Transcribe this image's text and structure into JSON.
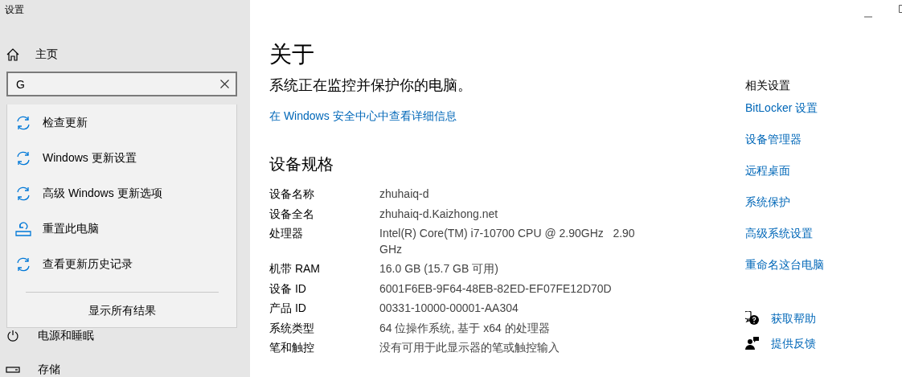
{
  "window": {
    "title": "设置"
  },
  "sidebar": {
    "home": "主页",
    "search": {
      "value": "G"
    },
    "suggestions": [
      {
        "label": "检查更新",
        "kind": "update"
      },
      {
        "label": "Windows 更新设置",
        "kind": "update"
      },
      {
        "label": "高级 Windows 更新选项",
        "kind": "update"
      },
      {
        "label": "重置此电脑",
        "kind": "reset"
      },
      {
        "label": "查看更新历史记录",
        "kind": "update"
      }
    ],
    "show_all": "显示所有结果",
    "items": [
      {
        "label": "电源和睡眠",
        "kind": "power"
      },
      {
        "label": "存储",
        "kind": "storage"
      }
    ]
  },
  "main": {
    "title": "关于",
    "status": "系统正在监控并保护你的电脑。",
    "security_link": "在 Windows 安全中心中查看详细信息",
    "specs_title": "设备规格",
    "specs": [
      {
        "label": "设备名称",
        "value": "zhuhaiq-d"
      },
      {
        "label": "设备全名",
        "value": "zhuhaiq-d.Kaizhong.net"
      },
      {
        "label": "处理器",
        "value": "Intel(R) Core(TM) i7-10700 CPU @ 2.90GHz   2.90 GHz"
      },
      {
        "label": "机带 RAM",
        "value": "16.0 GB (15.7 GB 可用)"
      },
      {
        "label": "设备 ID",
        "value": "6001F6EB-9F64-48EB-82ED-EF07FE12D70D"
      },
      {
        "label": "产品 ID",
        "value": "00331-10000-00001-AA304"
      },
      {
        "label": "系统类型",
        "value": "64 位操作系统, 基于 x64 的处理器"
      },
      {
        "label": "笔和触控",
        "value": "没有可用于此显示器的笔或触控输入"
      }
    ]
  },
  "related": {
    "title": "相关设置",
    "links": [
      "BitLocker 设置",
      "设备管理器",
      "远程桌面",
      "系统保护",
      "高级系统设置",
      "重命名这台电脑"
    ]
  },
  "support": [
    {
      "label": "获取帮助",
      "kind": "help"
    },
    {
      "label": "提供反馈",
      "kind": "feedback"
    }
  ]
}
